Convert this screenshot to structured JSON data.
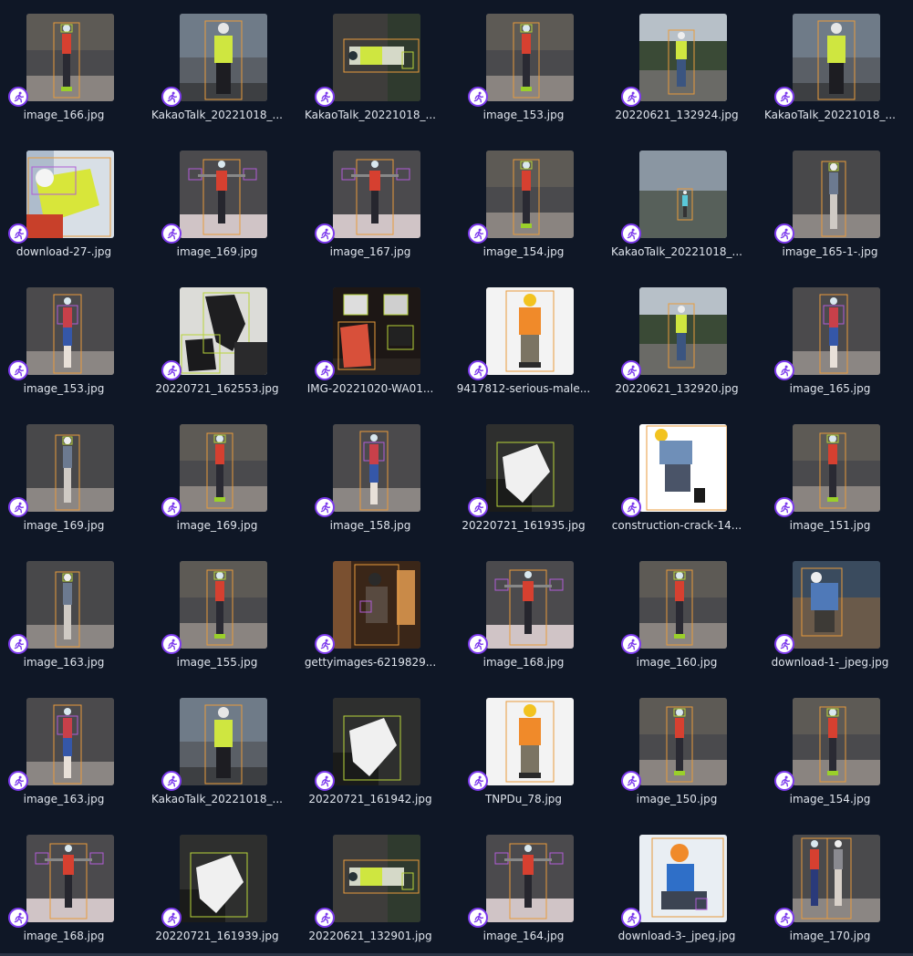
{
  "colors": {
    "background": "#0f1726",
    "badge_border": "#7c3aed",
    "filename_text": "#dfe4ec",
    "box_orange": "#e89b3c",
    "box_purple": "#b05cd6",
    "box_green": "#b8d43a"
  },
  "badge_icon": "person-running-icon",
  "files": [
    {
      "name": "image_166.jpg",
      "scene": "vest"
    },
    {
      "name": "KakaoTalk_20221018_...",
      "scene": "vest-yellow"
    },
    {
      "name": "KakaoTalk_20221018_...",
      "scene": "lying"
    },
    {
      "name": "image_153.jpg",
      "scene": "vest"
    },
    {
      "name": "20220621_132924.jpg",
      "scene": "outdoor"
    },
    {
      "name": "KakaoTalk_20221018_...",
      "scene": "vest-yellow"
    },
    {
      "name": "download-27-.jpg",
      "scene": "scaffold"
    },
    {
      "name": "image_169.jpg",
      "scene": "arms"
    },
    {
      "name": "image_167.jpg",
      "scene": "arms"
    },
    {
      "name": "image_154.jpg",
      "scene": "vest"
    },
    {
      "name": "KakaoTalk_20221018_...",
      "scene": "far"
    },
    {
      "name": "image_165-1-.jpg",
      "scene": "plain"
    },
    {
      "name": "image_153.jpg",
      "scene": "blue"
    },
    {
      "name": "20220721_162553.jpg",
      "scene": "gloves-black"
    },
    {
      "name": "IMG-20221020-WA01...",
      "scene": "items"
    },
    {
      "name": "9417812-serious-male...",
      "scene": "white-worker"
    },
    {
      "name": "20220621_132920.jpg",
      "scene": "outdoor"
    },
    {
      "name": "image_165.jpg",
      "scene": "blue"
    },
    {
      "name": "image_169.jpg",
      "scene": "plain"
    },
    {
      "name": "image_169.jpg",
      "scene": "vest"
    },
    {
      "name": "image_158.jpg",
      "scene": "blue"
    },
    {
      "name": "20220721_161935.jpg",
      "scene": "glove-white"
    },
    {
      "name": "construction-crack-14...",
      "scene": "kneel"
    },
    {
      "name": "image_151.jpg",
      "scene": "vest"
    },
    {
      "name": "image_163.jpg",
      "scene": "plain"
    },
    {
      "name": "image_155.jpg",
      "scene": "vest"
    },
    {
      "name": "gettyimages-6219829...",
      "scene": "factory"
    },
    {
      "name": "image_168.jpg",
      "scene": "arms"
    },
    {
      "name": "image_160.jpg",
      "scene": "vest"
    },
    {
      "name": "download-1-_jpeg.jpg",
      "scene": "bend"
    },
    {
      "name": "image_163.jpg",
      "scene": "blue"
    },
    {
      "name": "KakaoTalk_20221018_...",
      "scene": "vest-yellow"
    },
    {
      "name": "20220721_161942.jpg",
      "scene": "glove-white"
    },
    {
      "name": "TNPDu_78.jpg",
      "scene": "white-worker"
    },
    {
      "name": "image_150.jpg",
      "scene": "vest"
    },
    {
      "name": "image_154.jpg",
      "scene": "vest"
    },
    {
      "name": "image_168.jpg",
      "scene": "arms"
    },
    {
      "name": "20220721_161939.jpg",
      "scene": "glove-white"
    },
    {
      "name": "20220621_132901.jpg",
      "scene": "lying"
    },
    {
      "name": "image_164.jpg",
      "scene": "arms"
    },
    {
      "name": "download-3-_jpeg.jpg",
      "scene": "crouch"
    },
    {
      "name": "image_170.jpg",
      "scene": "two"
    }
  ]
}
